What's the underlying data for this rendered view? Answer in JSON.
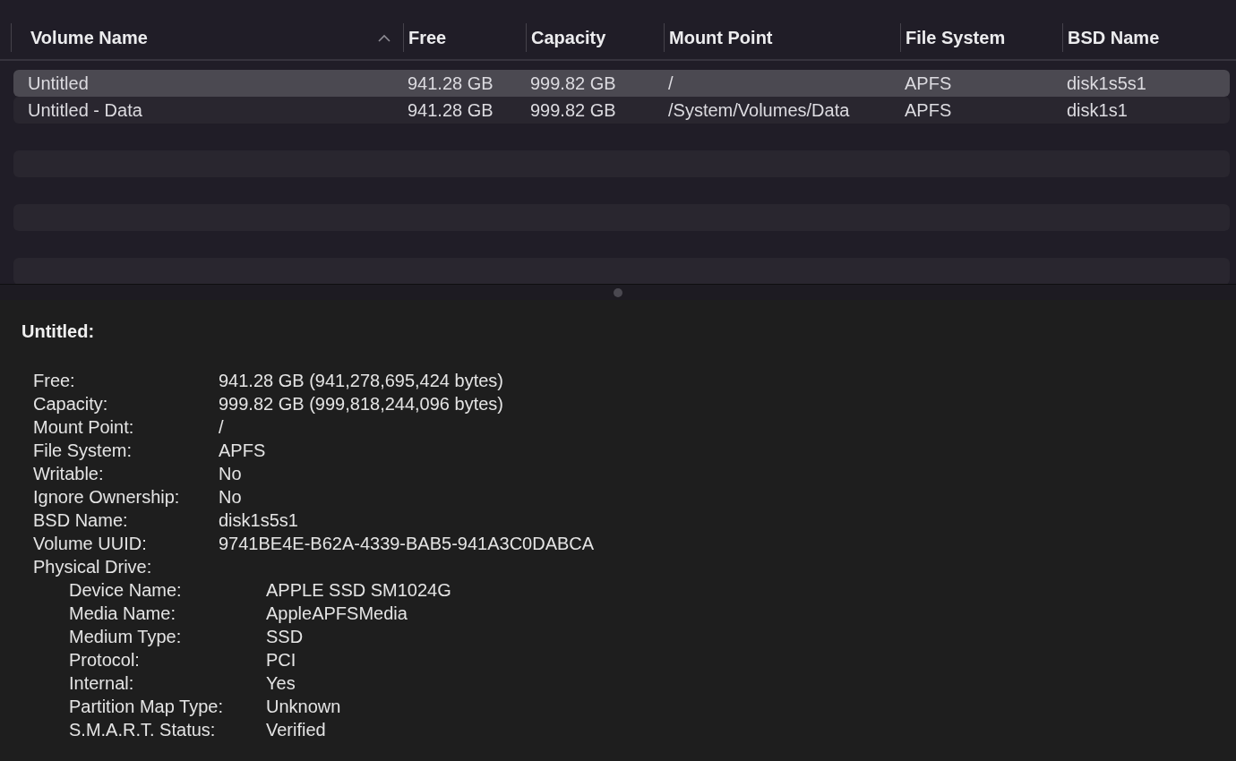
{
  "table": {
    "columns": [
      {
        "label": "Volume Name",
        "sorted": true
      },
      {
        "label": "Free",
        "sorted": false
      },
      {
        "label": "Capacity",
        "sorted": false
      },
      {
        "label": "Mount Point",
        "sorted": false
      },
      {
        "label": "File System",
        "sorted": false
      },
      {
        "label": "BSD Name",
        "sorted": false
      }
    ],
    "rows": [
      {
        "selected": true,
        "cells": [
          "Untitled",
          "941.28 GB",
          "999.82 GB",
          "/",
          "APFS",
          "disk1s5s1"
        ]
      },
      {
        "selected": false,
        "cells": [
          "Untitled - Data",
          "941.28 GB",
          "999.82 GB",
          "/System/Volumes/Data",
          "APFS",
          "disk1s1"
        ]
      }
    ]
  },
  "details": {
    "title": "Untitled:",
    "properties": [
      {
        "label": "Free:",
        "value": "941.28 GB (941,278,695,424 bytes)"
      },
      {
        "label": "Capacity:",
        "value": "999.82 GB (999,818,244,096 bytes)"
      },
      {
        "label": "Mount Point:",
        "value": "/"
      },
      {
        "label": "File System:",
        "value": "APFS"
      },
      {
        "label": "Writable:",
        "value": "No"
      },
      {
        "label": "Ignore Ownership:",
        "value": "No"
      },
      {
        "label": "BSD Name:",
        "value": "disk1s5s1"
      },
      {
        "label": "Volume UUID:",
        "value": "9741BE4E-B62A-4339-BAB5-941A3C0DABCA"
      },
      {
        "label": "Physical Drive:",
        "children": [
          {
            "label": "Device Name:",
            "value": "APPLE SSD SM1024G"
          },
          {
            "label": "Media Name:",
            "value": "AppleAPFSMedia"
          },
          {
            "label": "Medium Type:",
            "value": "SSD"
          },
          {
            "label": "Protocol:",
            "value": "PCI"
          },
          {
            "label": "Internal:",
            "value": "Yes"
          },
          {
            "label": "Partition Map Type:",
            "value": "Unknown"
          },
          {
            "label": "S.M.A.R.T. Status:",
            "value": "Verified"
          }
        ]
      }
    ]
  }
}
